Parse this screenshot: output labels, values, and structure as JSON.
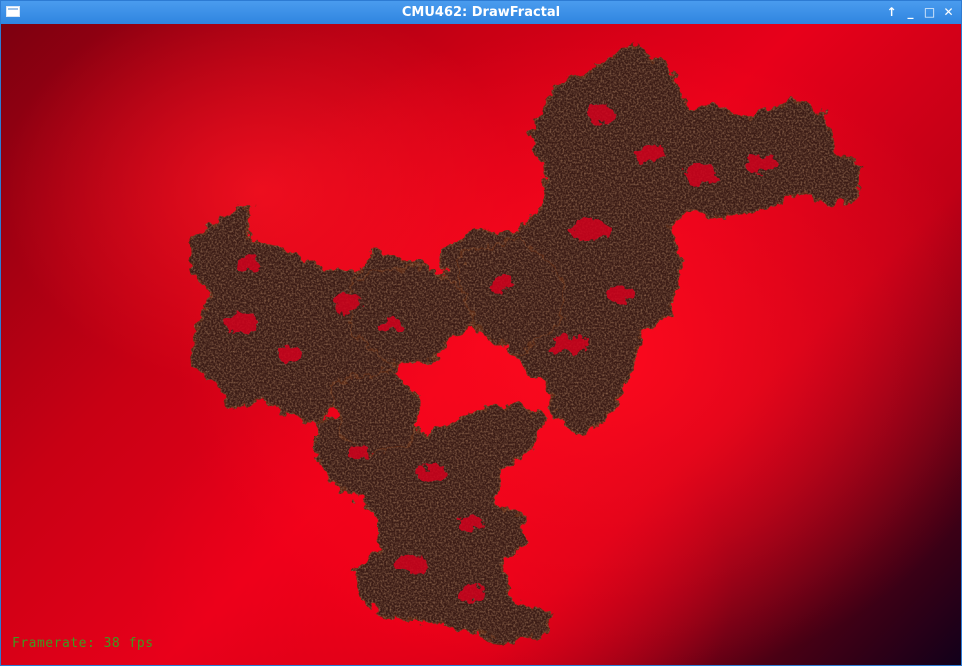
{
  "window": {
    "title": "CMU462: DrawFractal",
    "controls": {
      "up_icon": "↑",
      "minimize_icon": "_",
      "maximize_icon": "□",
      "close_icon": "✕"
    }
  },
  "canvas": {
    "framerate_label": "Framerate: 38 fps",
    "colors": {
      "background_center": "#ff0a1e",
      "background_dark": "#12001a",
      "fractal_fill": "#3a1a12",
      "fractal_edge": "#5a2a18",
      "framerate_text": "#3e9a1e"
    }
  }
}
